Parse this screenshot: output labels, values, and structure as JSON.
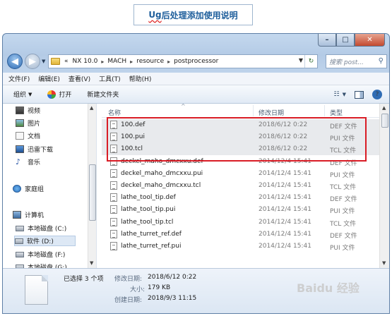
{
  "heading": {
    "prefix": "Ug",
    "rest": " 后处理添加使用说明"
  },
  "window": {
    "caption_buttons": {
      "minimize": "–",
      "maximize": "□",
      "close": "✕"
    },
    "address": {
      "overflow": "«",
      "crumbs": [
        "NX 10.0",
        "MACH",
        "resource",
        "postprocessor"
      ]
    },
    "search": {
      "placeholder": "搜索 post..."
    },
    "menu": [
      "文件(F)",
      "编辑(E)",
      "查看(V)",
      "工具(T)",
      "帮助(H)"
    ],
    "toolbar": {
      "organize": "组织",
      "open": "打开",
      "new_folder": "新建文件夹"
    },
    "nav": {
      "items": [
        {
          "label": "视频",
          "icon": "video-icon"
        },
        {
          "label": "图片",
          "icon": "pictures-icon"
        },
        {
          "label": "文档",
          "icon": "documents-icon"
        },
        {
          "label": "迅雷下载",
          "icon": "thunder-download-icon"
        },
        {
          "label": "音乐",
          "icon": "music-icon"
        },
        {
          "label": "家庭组",
          "icon": "homegroup-icon"
        },
        {
          "label": "计算机",
          "icon": "computer-icon"
        },
        {
          "label": "本地磁盘 (C:)",
          "icon": "drive-icon"
        },
        {
          "label": "软件 (D:)",
          "icon": "drive-icon"
        },
        {
          "label": "本地磁盘 (F:)",
          "icon": "drive-icon"
        },
        {
          "label": "本地磁盘 (G:)",
          "icon": "drive-icon"
        }
      ]
    },
    "columns": {
      "name": "名称",
      "date": "修改日期",
      "type": "类型"
    },
    "files": [
      {
        "name": "100.def",
        "date": "2018/6/12 0:22",
        "type": "DEF 文件"
      },
      {
        "name": "100.pui",
        "date": "2018/6/12 0:22",
        "type": "PUI 文件"
      },
      {
        "name": "100.tcl",
        "date": "2018/6/12 0:22",
        "type": "TCL 文件"
      },
      {
        "name": "deckel_maho_dmcxxu.def",
        "date": "2014/12/4 15:41",
        "type": "DEF 文件"
      },
      {
        "name": "deckel_maho_dmcxxu.pui",
        "date": "2014/12/4 15:41",
        "type": "PUI 文件"
      },
      {
        "name": "deckel_maho_dmcxxu.tcl",
        "date": "2014/12/4 15:41",
        "type": "TCL 文件"
      },
      {
        "name": "lathe_tool_tip.def",
        "date": "2014/12/4 15:41",
        "type": "DEF 文件"
      },
      {
        "name": "lathe_tool_tip.pui",
        "date": "2014/12/4 15:41",
        "type": "PUI 文件"
      },
      {
        "name": "lathe_tool_tip.tcl",
        "date": "2014/12/4 15:41",
        "type": "TCL 文件"
      },
      {
        "name": "lathe_turret_ref.def",
        "date": "2014/12/4 15:41",
        "type": "DEF 文件"
      },
      {
        "name": "lathe_turret_ref.pui",
        "date": "2014/12/4 15:41",
        "type": "PUI 文件"
      }
    ],
    "details": {
      "selected": "已选择 3 个项",
      "modified_label": "修改日期:",
      "modified_value": "2018/6/12 0:22",
      "size_label": "大小:",
      "size_value": "179 KB",
      "created_label": "创建日期:",
      "created_value": "2018/9/3 11:15"
    }
  },
  "watermark": "Baidu 经验"
}
